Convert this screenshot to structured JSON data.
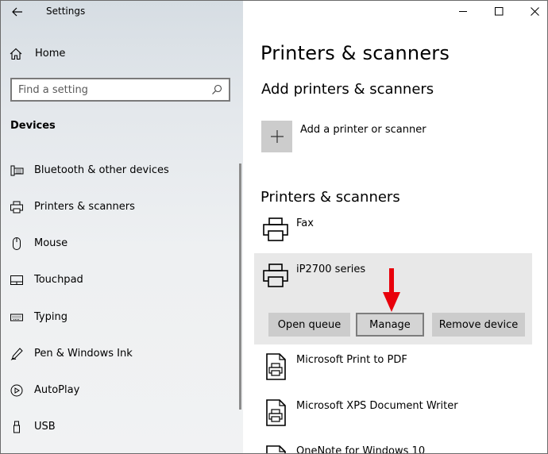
{
  "app": {
    "title": "Settings"
  },
  "sidebar": {
    "home_label": "Home",
    "search": {
      "placeholder": "Find a setting",
      "value": ""
    },
    "section_title": "Devices",
    "items": [
      {
        "label": "Bluetooth & other devices",
        "icon": "bluetooth-devices-icon"
      },
      {
        "label": "Printers & scanners",
        "icon": "printer-icon"
      },
      {
        "label": "Mouse",
        "icon": "mouse-icon"
      },
      {
        "label": "Touchpad",
        "icon": "touchpad-icon"
      },
      {
        "label": "Typing",
        "icon": "keyboard-icon"
      },
      {
        "label": "Pen & Windows Ink",
        "icon": "pen-icon"
      },
      {
        "label": "AutoPlay",
        "icon": "autoplay-icon"
      },
      {
        "label": "USB",
        "icon": "usb-icon"
      }
    ]
  },
  "main": {
    "title": "Printers & scanners",
    "add_section_title": "Add printers & scanners",
    "add_button_label": "Add a printer or scanner",
    "list_section_title": "Printers & scanners",
    "devices": [
      {
        "name": "Fax"
      },
      {
        "name": "iP2700 series",
        "selected": true
      },
      {
        "name": "Microsoft Print to PDF"
      },
      {
        "name": "Microsoft XPS Document Writer"
      },
      {
        "name": "OneNote for Windows 10"
      }
    ],
    "actions": {
      "open_queue": "Open queue",
      "manage": "Manage",
      "remove_device": "Remove device"
    }
  },
  "colors": {
    "annotation_arrow": "#e8000b",
    "selected_row": "#e8e8e8",
    "button_bg": "#cccccc"
  }
}
